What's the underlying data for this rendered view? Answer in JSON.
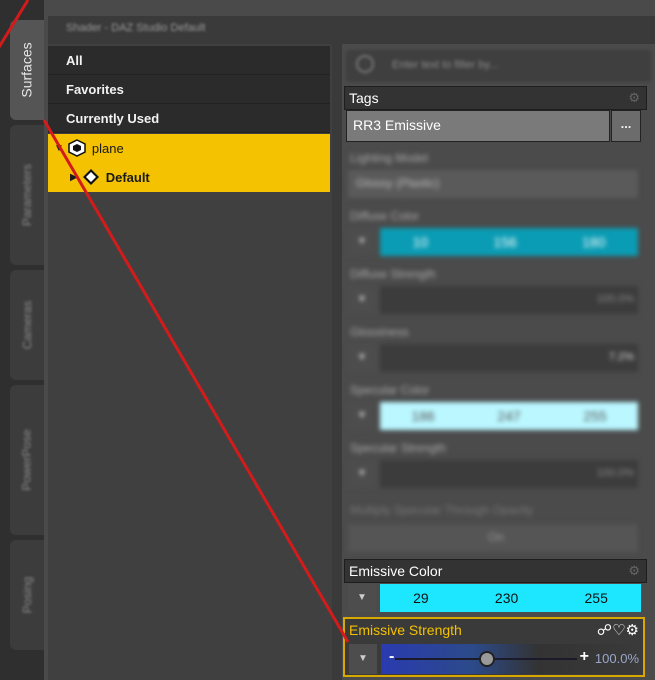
{
  "tabs": {
    "active": "Surfaces",
    "inactive": [
      "Parameters",
      "Cameras",
      "PowerPose",
      "Posing"
    ]
  },
  "header": {
    "title": "Shader - DAZ Studio Default"
  },
  "tree": {
    "all": "All",
    "favorites": "Favorites",
    "currently_used": "Currently Used",
    "node": "plane",
    "child": "Default"
  },
  "search": {
    "placeholder": "Enter text to filter by..."
  },
  "tags": {
    "label": "Tags",
    "value": "RR3 Emissive",
    "button": "..."
  },
  "blurred": {
    "lighting_model": "Lighting Model",
    "lighting_value": "Glossy (Plastic)",
    "diffuse_color": "Diffuse Color",
    "diffuse_rgb": [
      "10",
      "156",
      "180"
    ],
    "diffuse_strength": "Diffuse Strength",
    "diffuse_strength_value": "100.0%",
    "glossiness": "Glossiness",
    "glossiness_value": "7.2%",
    "specular_color": "Specular Color",
    "specular_rgb": [
      "186",
      "247",
      "255"
    ],
    "specular_strength": "Specular Strength",
    "specular_strength_value": "100.0%",
    "multiply": "Multiply Specular Through Opacity",
    "on_label": "On"
  },
  "emissive_color": {
    "label": "Emissive Color",
    "r": "29",
    "g": "230",
    "b": "255"
  },
  "emissive_strength": {
    "label": "Emissive Strength",
    "minus": "-",
    "plus": "+",
    "value": "100.0%"
  },
  "colors": {
    "selection": "#f4c200",
    "emissive_swatch": "#1de6ff",
    "diffuse_swatch": "#0a9cb4",
    "specular_swatch": "#baf7ff",
    "annotation": "#d41b1b"
  },
  "icons": [
    "folder-icon",
    "material-icon",
    "gear-icon",
    "link-icon",
    "heart-icon",
    "search-icon"
  ]
}
